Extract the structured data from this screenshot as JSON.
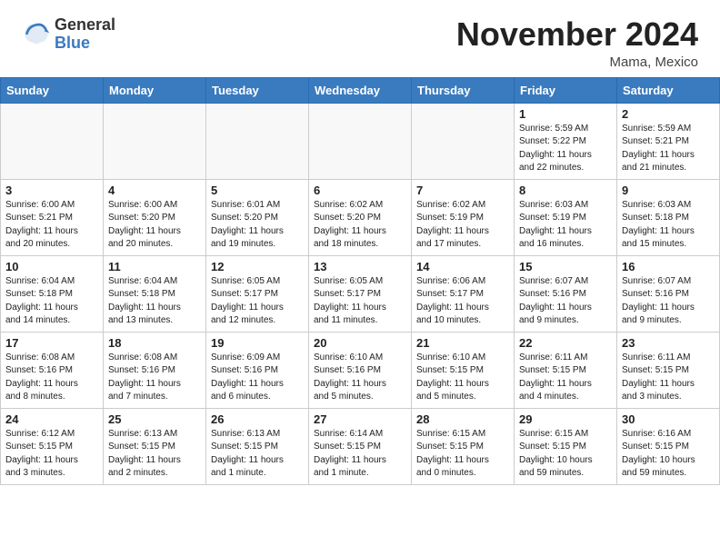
{
  "header": {
    "logo_general": "General",
    "logo_blue": "Blue",
    "month": "November 2024",
    "location": "Mama, Mexico"
  },
  "weekdays": [
    "Sunday",
    "Monday",
    "Tuesday",
    "Wednesday",
    "Thursday",
    "Friday",
    "Saturday"
  ],
  "weeks": [
    [
      {
        "day": "",
        "info": ""
      },
      {
        "day": "",
        "info": ""
      },
      {
        "day": "",
        "info": ""
      },
      {
        "day": "",
        "info": ""
      },
      {
        "day": "",
        "info": ""
      },
      {
        "day": "1",
        "info": "Sunrise: 5:59 AM\nSunset: 5:22 PM\nDaylight: 11 hours\nand 22 minutes."
      },
      {
        "day": "2",
        "info": "Sunrise: 5:59 AM\nSunset: 5:21 PM\nDaylight: 11 hours\nand 21 minutes."
      }
    ],
    [
      {
        "day": "3",
        "info": "Sunrise: 6:00 AM\nSunset: 5:21 PM\nDaylight: 11 hours\nand 20 minutes."
      },
      {
        "day": "4",
        "info": "Sunrise: 6:00 AM\nSunset: 5:20 PM\nDaylight: 11 hours\nand 20 minutes."
      },
      {
        "day": "5",
        "info": "Sunrise: 6:01 AM\nSunset: 5:20 PM\nDaylight: 11 hours\nand 19 minutes."
      },
      {
        "day": "6",
        "info": "Sunrise: 6:02 AM\nSunset: 5:20 PM\nDaylight: 11 hours\nand 18 minutes."
      },
      {
        "day": "7",
        "info": "Sunrise: 6:02 AM\nSunset: 5:19 PM\nDaylight: 11 hours\nand 17 minutes."
      },
      {
        "day": "8",
        "info": "Sunrise: 6:03 AM\nSunset: 5:19 PM\nDaylight: 11 hours\nand 16 minutes."
      },
      {
        "day": "9",
        "info": "Sunrise: 6:03 AM\nSunset: 5:18 PM\nDaylight: 11 hours\nand 15 minutes."
      }
    ],
    [
      {
        "day": "10",
        "info": "Sunrise: 6:04 AM\nSunset: 5:18 PM\nDaylight: 11 hours\nand 14 minutes."
      },
      {
        "day": "11",
        "info": "Sunrise: 6:04 AM\nSunset: 5:18 PM\nDaylight: 11 hours\nand 13 minutes."
      },
      {
        "day": "12",
        "info": "Sunrise: 6:05 AM\nSunset: 5:17 PM\nDaylight: 11 hours\nand 12 minutes."
      },
      {
        "day": "13",
        "info": "Sunrise: 6:05 AM\nSunset: 5:17 PM\nDaylight: 11 hours\nand 11 minutes."
      },
      {
        "day": "14",
        "info": "Sunrise: 6:06 AM\nSunset: 5:17 PM\nDaylight: 11 hours\nand 10 minutes."
      },
      {
        "day": "15",
        "info": "Sunrise: 6:07 AM\nSunset: 5:16 PM\nDaylight: 11 hours\nand 9 minutes."
      },
      {
        "day": "16",
        "info": "Sunrise: 6:07 AM\nSunset: 5:16 PM\nDaylight: 11 hours\nand 9 minutes."
      }
    ],
    [
      {
        "day": "17",
        "info": "Sunrise: 6:08 AM\nSunset: 5:16 PM\nDaylight: 11 hours\nand 8 minutes."
      },
      {
        "day": "18",
        "info": "Sunrise: 6:08 AM\nSunset: 5:16 PM\nDaylight: 11 hours\nand 7 minutes."
      },
      {
        "day": "19",
        "info": "Sunrise: 6:09 AM\nSunset: 5:16 PM\nDaylight: 11 hours\nand 6 minutes."
      },
      {
        "day": "20",
        "info": "Sunrise: 6:10 AM\nSunset: 5:16 PM\nDaylight: 11 hours\nand 5 minutes."
      },
      {
        "day": "21",
        "info": "Sunrise: 6:10 AM\nSunset: 5:15 PM\nDaylight: 11 hours\nand 5 minutes."
      },
      {
        "day": "22",
        "info": "Sunrise: 6:11 AM\nSunset: 5:15 PM\nDaylight: 11 hours\nand 4 minutes."
      },
      {
        "day": "23",
        "info": "Sunrise: 6:11 AM\nSunset: 5:15 PM\nDaylight: 11 hours\nand 3 minutes."
      }
    ],
    [
      {
        "day": "24",
        "info": "Sunrise: 6:12 AM\nSunset: 5:15 PM\nDaylight: 11 hours\nand 3 minutes."
      },
      {
        "day": "25",
        "info": "Sunrise: 6:13 AM\nSunset: 5:15 PM\nDaylight: 11 hours\nand 2 minutes."
      },
      {
        "day": "26",
        "info": "Sunrise: 6:13 AM\nSunset: 5:15 PM\nDaylight: 11 hours\nand 1 minute."
      },
      {
        "day": "27",
        "info": "Sunrise: 6:14 AM\nSunset: 5:15 PM\nDaylight: 11 hours\nand 1 minute."
      },
      {
        "day": "28",
        "info": "Sunrise: 6:15 AM\nSunset: 5:15 PM\nDaylight: 11 hours\nand 0 minutes."
      },
      {
        "day": "29",
        "info": "Sunrise: 6:15 AM\nSunset: 5:15 PM\nDaylight: 10 hours\nand 59 minutes."
      },
      {
        "day": "30",
        "info": "Sunrise: 6:16 AM\nSunset: 5:15 PM\nDaylight: 10 hours\nand 59 minutes."
      }
    ]
  ]
}
